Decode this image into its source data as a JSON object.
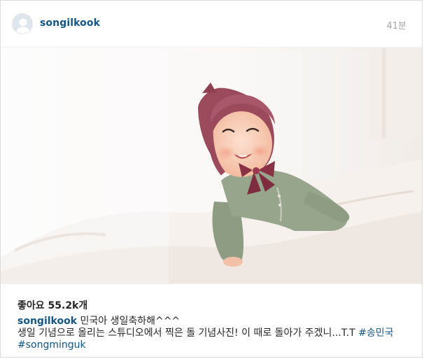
{
  "post": {
    "username": "songilkook",
    "timestamp": "41분",
    "photo_alt": "",
    "likes_label": "좋아요 55.2k개",
    "caption": {
      "username": "songilkook",
      "line1": "민국아 생일축하해^^^",
      "line2": "생일 기념으로 올리는 스튜디오에서 찍은 돌 기념사진! 이 때로 돌아가 주겠니...T.T",
      "hashtag1": "#송민국",
      "hashtag2": "#songminguk"
    }
  },
  "colors": {
    "link": "#125688",
    "text": "#262626",
    "muted": "#a5a7aa",
    "border": "#dbdbdb"
  },
  "icons": {
    "avatar": "default-profile-icon"
  }
}
